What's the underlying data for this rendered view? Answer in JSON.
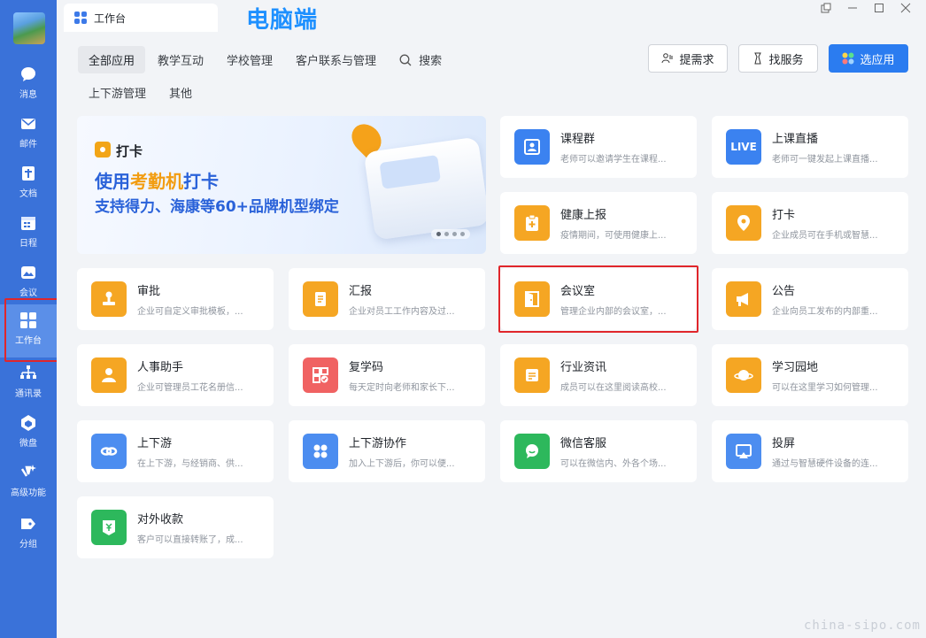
{
  "window": {
    "tab_title": "工作台",
    "overlay_label": "电脑端"
  },
  "sidebar": {
    "items": [
      {
        "label": "消息",
        "icon": "chat-icon"
      },
      {
        "label": "邮件",
        "icon": "mail-icon"
      },
      {
        "label": "文档",
        "icon": "document-icon"
      },
      {
        "label": "日程",
        "icon": "calendar-icon"
      },
      {
        "label": "会议",
        "icon": "meeting-icon"
      },
      {
        "label": "工作台",
        "icon": "workbench-icon",
        "active": true
      },
      {
        "label": "通讯录",
        "icon": "contacts-icon"
      },
      {
        "label": "微盘",
        "icon": "drive-icon"
      },
      {
        "label": "高级功能",
        "icon": "sparkle-icon"
      },
      {
        "label": "分组",
        "icon": "tag-icon"
      }
    ]
  },
  "categories": {
    "row1": [
      "全部应用",
      "教学互动",
      "学校管理",
      "客户联系与管理"
    ],
    "search_label": "搜索",
    "row2": [
      "上下游管理",
      "其他"
    ]
  },
  "actions": {
    "request": "提需求",
    "service": "找服务",
    "select_app": "选应用"
  },
  "banner": {
    "tag": "打卡",
    "line1_prefix": "使用",
    "line1_accent": "考勤机",
    "line1_suffix": "打卡",
    "line2": "支持得力、海康等60+品牌机型绑定"
  },
  "apps": [
    {
      "name": "课程群",
      "desc": "老师可以邀请学生在课程...",
      "color": "#3b82f0",
      "icon": "contact-card-icon"
    },
    {
      "name": "上课直播",
      "desc": "老师可一键发起上课直播...",
      "color": "#3b82f0",
      "icon": "live-icon",
      "badge": "LIVE"
    },
    {
      "name": "健康上报",
      "desc": "疫情期间，可使用健康上...",
      "color": "#f5a623",
      "icon": "clipboard-plus-icon"
    },
    {
      "name": "打卡",
      "desc": "企业成员可在手机或智慧...",
      "color": "#f5a623",
      "icon": "location-pin-icon"
    },
    {
      "name": "审批",
      "desc": "企业可自定义审批模板，...",
      "color": "#f5a623",
      "icon": "stamp-icon"
    },
    {
      "name": "汇报",
      "desc": "企业对员工工作内容及过...",
      "color": "#f5a623",
      "icon": "report-icon"
    },
    {
      "name": "会议室",
      "desc": "管理企业内部的会议室，...",
      "color": "#f5a623",
      "icon": "door-icon"
    },
    {
      "name": "公告",
      "desc": "企业向员工发布的内部重...",
      "color": "#f5a623",
      "icon": "megaphone-icon"
    },
    {
      "name": "人事助手",
      "desc": "企业可管理员工花名册信...",
      "color": "#f5a623",
      "icon": "person-icon"
    },
    {
      "name": "复学码",
      "desc": "每天定时向老师和家长下...",
      "color": "#f06262",
      "icon": "qr-check-icon"
    },
    {
      "name": "行业资讯",
      "desc": "成员可以在这里阅读高校...",
      "color": "#f5a623",
      "icon": "news-icon"
    },
    {
      "name": "学习园地",
      "desc": "可以在这里学习如何管理...",
      "color": "#f5a623",
      "icon": "planet-icon"
    },
    {
      "name": "上下游",
      "desc": "在上下游，与经销商、供...",
      "color": "#4c8df0",
      "icon": "link-icon"
    },
    {
      "name": "上下游协作",
      "desc": "加入上下游后，你可以便...",
      "color": "#4c8df0",
      "icon": "grid-icon"
    },
    {
      "name": "微信客服",
      "desc": "可以在微信内、外各个场...",
      "color": "#2db85c",
      "icon": "wechat-service-icon"
    },
    {
      "name": "投屏",
      "desc": "通过与智慧硬件设备的连...",
      "color": "#4c8df0",
      "icon": "screen-cast-icon"
    },
    {
      "name": "对外收款",
      "desc": "客户可以直接转账了，成...",
      "color": "#2db85c",
      "icon": "payment-icon"
    }
  ],
  "watermark": "china-sipo.com"
}
